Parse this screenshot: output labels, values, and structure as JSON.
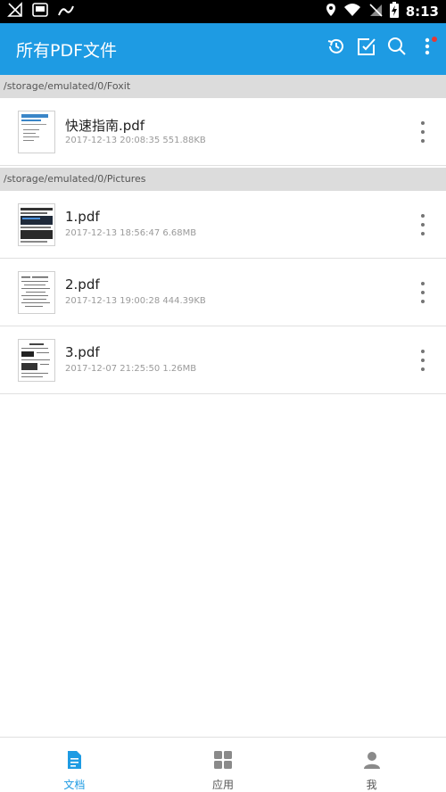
{
  "status_bar": {
    "time": "8:13",
    "left_icons": [
      "no-signal-icon",
      "screenshot-icon",
      "cast-icon"
    ],
    "right_icons": [
      "location-icon",
      "wifi-icon",
      "no-sim-icon",
      "battery-charging-icon"
    ]
  },
  "app_bar": {
    "title": "所有PDF文件",
    "actions": [
      "history-icon",
      "select-icon",
      "search-icon",
      "more-vert-icon"
    ],
    "accent": "#1e9be3"
  },
  "sections": [
    {
      "path": "/storage/emulated/0/Foxit",
      "files": [
        {
          "name": "快速指南.pdf",
          "meta": "2017-12-13 20:08:35 551.88KB"
        }
      ]
    },
    {
      "path": "/storage/emulated/0/Pictures",
      "files": [
        {
          "name": "1.pdf",
          "meta": "2017-12-13 18:56:47 6.68MB"
        },
        {
          "name": "2.pdf",
          "meta": "2017-12-13 19:00:28 444.39KB"
        },
        {
          "name": "3.pdf",
          "meta": "2017-12-07 21:25:50 1.26MB"
        }
      ]
    }
  ],
  "bottom_nav": {
    "items": [
      {
        "label": "文档",
        "icon": "document-icon",
        "active": true
      },
      {
        "label": "应用",
        "icon": "apps-grid-icon",
        "active": false
      },
      {
        "label": "我",
        "icon": "person-icon",
        "active": false
      }
    ]
  }
}
